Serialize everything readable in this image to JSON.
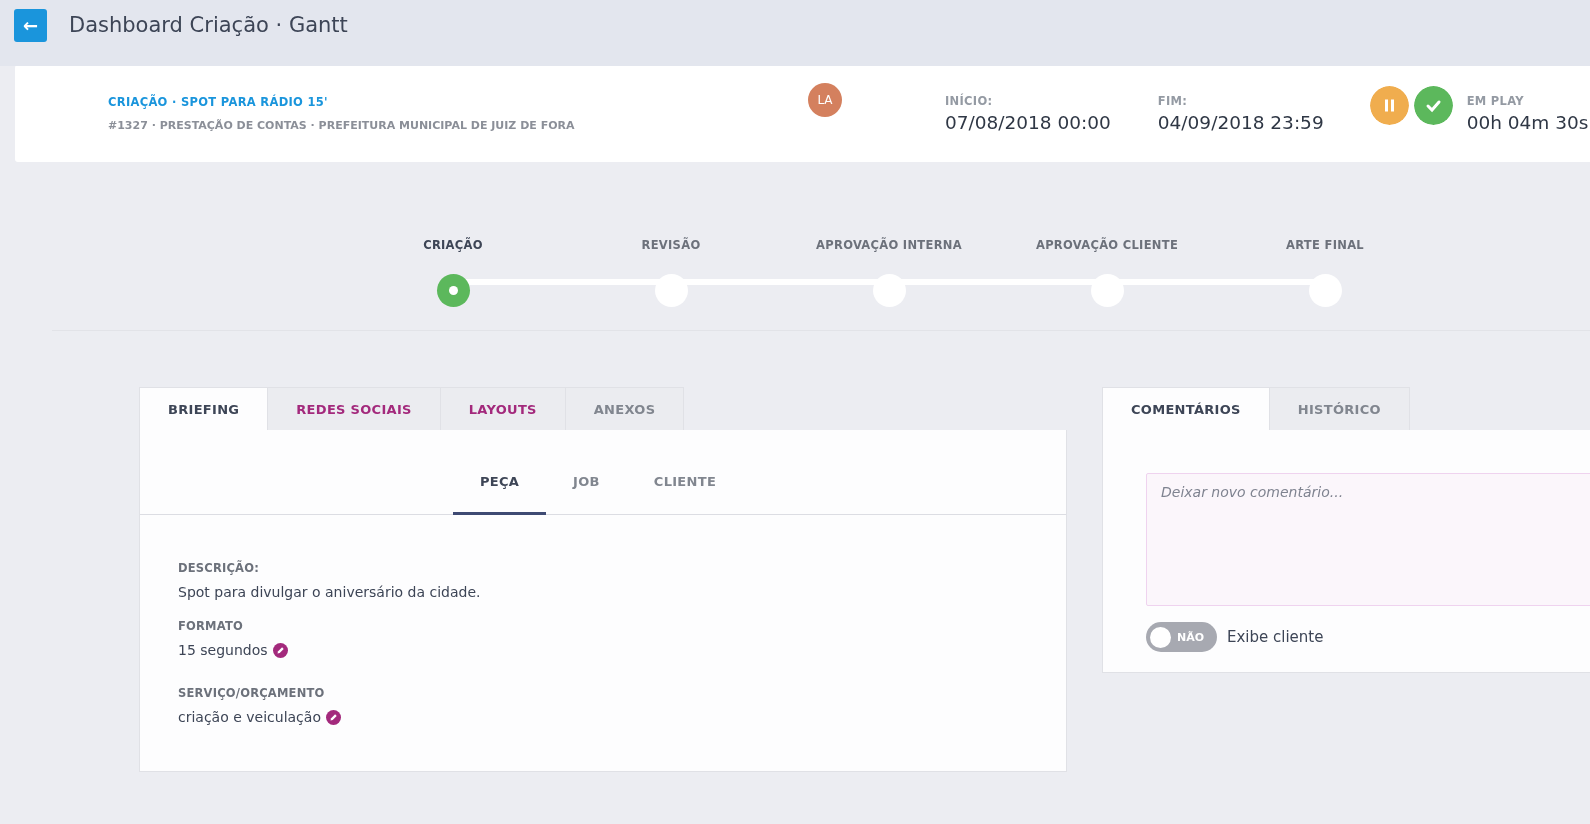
{
  "topbar": {
    "back_button": "←",
    "title": "Dashboard Criação · Gantt"
  },
  "job": {
    "title": "CRIAÇÃO · SPOT PARA RÁDIO 15'",
    "subtitle": "#1327 · PRESTAÇÃO DE CONTAS · PREFEITURA MUNICIPAL DE JUIZ DE FORA",
    "avatar": "LA",
    "start_label": "INÍCIO:",
    "start": "07/08/2018 00:00",
    "end_label": "FIM:",
    "end": "04/09/2018 23:59",
    "timer_label": "EM PLAY",
    "timer": "00h 04m 30s"
  },
  "steps": [
    {
      "label": "CRIAÇÃO",
      "selected": true
    },
    {
      "label": "REVISÃO",
      "selected": false
    },
    {
      "label": "APROVAÇÃO INTERNA",
      "selected": false
    },
    {
      "label": "APROVAÇÃO CLIENTE",
      "selected": false
    },
    {
      "label": "ARTE FINAL",
      "selected": false
    }
  ],
  "tabs": [
    {
      "label": "BRIEFING",
      "selected": true,
      "highlighted": false
    },
    {
      "label": "REDES SOCIAIS",
      "selected": false,
      "highlighted": true
    },
    {
      "label": "LAYOUTS",
      "selected": false,
      "highlighted": true
    },
    {
      "label": "ANEXOS",
      "selected": false,
      "highlighted": false
    }
  ],
  "subtabs": [
    {
      "label": "PEÇA",
      "selected": true
    },
    {
      "label": "JOB",
      "selected": false
    },
    {
      "label": "CLIENTE",
      "selected": false
    }
  ],
  "fields": [
    {
      "label": "DESCRIÇÃO:",
      "value": "Spot para divulgar o aniversário da cidade.",
      "editable": false
    },
    {
      "label": "FORMATO",
      "value": "15 segundos",
      "editable": true
    },
    {
      "label": "SERVIÇO/ORÇAMENTO",
      "value": "criação e veiculação",
      "editable": true
    }
  ],
  "comments": {
    "tabs": [
      {
        "label": "COMENTÁRIOS",
        "selected": true
      },
      {
        "label": "HISTÓRICO",
        "selected": false
      }
    ],
    "placeholder": "Deixar novo comentário...",
    "toggle": {
      "on": false,
      "text": "NÃO",
      "label": "Exibe cliente"
    }
  }
}
